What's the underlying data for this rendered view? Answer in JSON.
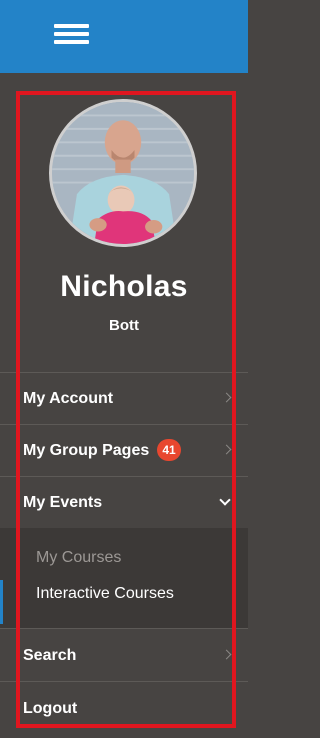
{
  "header": {
    "menu_icon": "hamburger-icon",
    "bar_color": "#2383c8"
  },
  "profile": {
    "first_name": "Nicholas",
    "last_name": "Bott",
    "avatar_alt": "profile photo"
  },
  "menu": {
    "my_account": {
      "label": "My Account",
      "icon": "chevron-right-icon"
    },
    "my_group_pages": {
      "label": "My Group Pages",
      "badge": "41",
      "icon": "chevron-right-icon"
    },
    "my_events": {
      "label": "My Events",
      "icon": "chevron-down-icon",
      "subitems": [
        {
          "label": "My Courses"
        },
        {
          "label": "Interactive Courses"
        }
      ]
    },
    "search": {
      "label": "Search",
      "icon": "chevron-right-icon"
    },
    "logout": {
      "label": "Logout"
    }
  },
  "colors": {
    "sidebar_bg": "#474442",
    "badge": "#e8472f",
    "highlight": "#e0161f"
  }
}
